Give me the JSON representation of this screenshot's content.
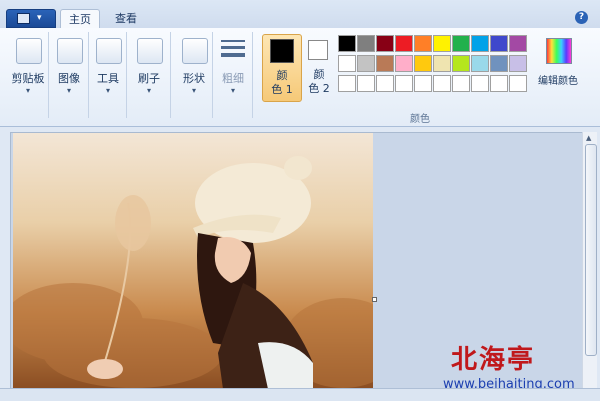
{
  "tabs": [
    "主页",
    "查看"
  ],
  "help_label": "?",
  "groups": {
    "clipboard": "剪贴板",
    "image": "图像",
    "tools": "工具",
    "brushes": "刷子",
    "shapes": "形状",
    "size": "粗细"
  },
  "colors": {
    "color1_label": [
      "颜",
      "色 1"
    ],
    "color2_label": [
      "颜",
      "色 2"
    ],
    "edit_colors": "编辑颜色",
    "group_label": "颜色",
    "color1_value": "#000000",
    "color2_value": "#ffffff",
    "palette_row1": [
      "#000000",
      "#7f7f7f",
      "#880015",
      "#ed1c24",
      "#ff7f27",
      "#fff200",
      "#22b14c",
      "#00a2e8",
      "#3f48cc",
      "#a349a4"
    ],
    "palette_row2": [
      "#ffffff",
      "#c3c3c3",
      "#b97a57",
      "#ffaec9",
      "#ffc90e",
      "#efe4b0",
      "#b5e61d",
      "#99d9ea",
      "#7092be",
      "#c8bfe7"
    ],
    "palette_row3": [
      "#ffffff",
      "#ffffff",
      "#ffffff",
      "#ffffff",
      "#ffffff",
      "#ffffff",
      "#ffffff",
      "#ffffff",
      "#ffffff",
      "#ffffff"
    ]
  },
  "watermark": {
    "title": "北海亭",
    "url": "www.beihaiting.com"
  }
}
